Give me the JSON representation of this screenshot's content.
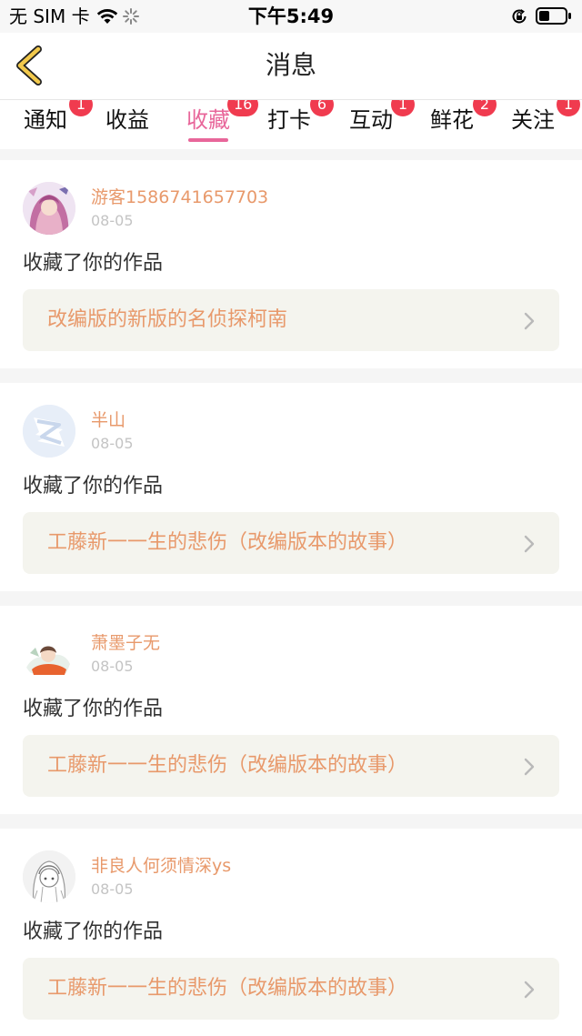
{
  "status_bar": {
    "carrier": "无 SIM 卡",
    "time": "下午5:49",
    "wifi_icon": "wifi-icon",
    "activity_icon": "loading-spinner-icon",
    "lock_icon": "rotation-lock-icon",
    "battery_icon": "battery-icon",
    "battery_level": 0.4
  },
  "nav": {
    "title": "消息",
    "back_icon": "chevron-left-icon"
  },
  "colors": {
    "accent_pink": "#e8669a",
    "badge_red": "#f03b4f",
    "name_orange": "#e8996b",
    "back_arrow_yellow": "#f2c94c"
  },
  "tabs": [
    {
      "label": "通知",
      "badge": "1",
      "active": false
    },
    {
      "label": "收益",
      "badge": "",
      "active": false
    },
    {
      "label": "收藏",
      "badge": "16",
      "active": true
    },
    {
      "label": "打卡",
      "badge": "6",
      "active": false
    },
    {
      "label": "互动",
      "badge": "1",
      "active": false
    },
    {
      "label": "鲜花",
      "badge": "2",
      "active": false
    },
    {
      "label": "关注",
      "badge": "1",
      "active": false
    }
  ],
  "messages": [
    {
      "user": "游客1586741657703",
      "date": "08-05",
      "action": "收藏了你的作品",
      "work_title": "改编版的新版的名侦探柯南",
      "avatar": "anime-girl-avatar"
    },
    {
      "user": "半山",
      "date": "08-05",
      "action": "收藏了你的作品",
      "work_title": "工藤新一一生的悲伤（改编版本的故事）",
      "avatar": "qq-logo-avatar"
    },
    {
      "user": "萧墨子无",
      "date": "08-05",
      "action": "收藏了你的作品",
      "work_title": "工藤新一一生的悲伤（改编版本的故事）",
      "avatar": "anime-boy-avatar"
    },
    {
      "user": "非良人何须情深ys",
      "date": "08-05",
      "action": "收藏了你的作品",
      "work_title": "工藤新一一生的悲伤（改编版本的故事）",
      "avatar": "sketch-girl-avatar"
    }
  ]
}
